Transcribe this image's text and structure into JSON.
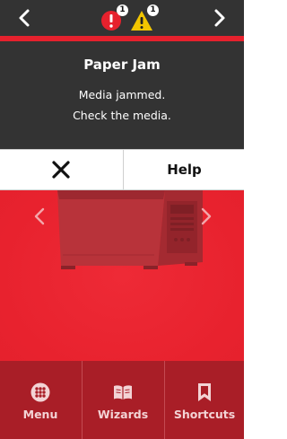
{
  "status_bar": {
    "nav_prev_icon": "chevron-left-icon",
    "nav_next_icon": "chevron-right-icon",
    "alerts": [
      {
        "icon": "error-icon",
        "color": "#e6212d",
        "count": "1"
      },
      {
        "icon": "warning-icon",
        "color": "#f2c500",
        "count": "1"
      }
    ]
  },
  "message": {
    "title": "Paper Jam",
    "line1": "Media jammed.",
    "line2": "Check the media."
  },
  "actions": {
    "close_icon": "close-icon",
    "help_label": "Help"
  },
  "illustration": {
    "prev_icon": "chevron-left-icon",
    "next_icon": "chevron-right-icon",
    "image": "printer-illustration"
  },
  "bottom_nav": {
    "items": [
      {
        "label": "Menu",
        "icon": "grid-dots-icon"
      },
      {
        "label": "Wizards",
        "icon": "open-book-icon"
      },
      {
        "label": "Shortcuts",
        "icon": "bookmark-icon"
      }
    ]
  },
  "colors": {
    "accent_red": "#e6212d",
    "dark_panel": "#333333",
    "bottom_nav": "#a91e27",
    "nav_label": "#f3d3d5"
  }
}
